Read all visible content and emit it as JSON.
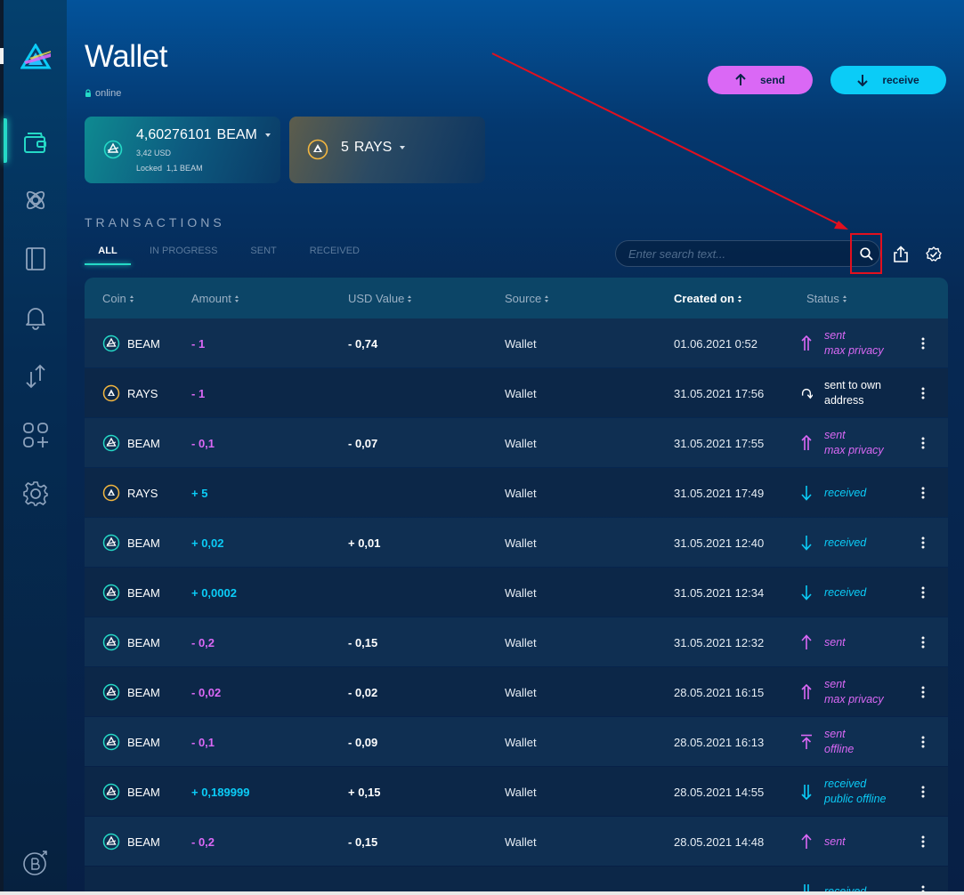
{
  "page": {
    "title": "Wallet",
    "status": "online"
  },
  "actions": {
    "send_label": "send",
    "receive_label": "receive"
  },
  "assets": {
    "beam": {
      "amount": "4,60276101",
      "unit": "BEAM",
      "usd": "3,42 USD",
      "locked_label": "Locked",
      "locked_value": "1,1 BEAM"
    },
    "rays": {
      "amount": "5",
      "unit": "RAYS"
    }
  },
  "transactions": {
    "section_title": "TRANSACTIONS",
    "tabs": [
      {
        "label": "ALL",
        "active": true
      },
      {
        "label": "IN PROGRESS",
        "active": false
      },
      {
        "label": "SENT",
        "active": false
      },
      {
        "label": "RECEIVED",
        "active": false
      }
    ],
    "search_placeholder": "Enter search text...",
    "columns": [
      "Coin",
      "Amount",
      "USD Value",
      "Source",
      "Created on",
      "Status"
    ],
    "sorted_column": "Created on",
    "rows": [
      {
        "coin": "BEAM",
        "amount": "- 1",
        "usd": "- 0,74",
        "source": "Wallet",
        "created": "01.06.2021 0:52",
        "status": "sent",
        "status_detail": "max privacy",
        "kind": "sent-mp"
      },
      {
        "coin": "RAYS",
        "amount": "- 1",
        "usd": "",
        "source": "Wallet",
        "created": "31.05.2021 17:56",
        "status": "sent to own",
        "status_detail": "address",
        "kind": "own"
      },
      {
        "coin": "BEAM",
        "amount": "- 0,1",
        "usd": "- 0,07",
        "source": "Wallet",
        "created": "31.05.2021 17:55",
        "status": "sent",
        "status_detail": "max privacy",
        "kind": "sent-mp"
      },
      {
        "coin": "RAYS",
        "amount": "+ 5",
        "usd": "",
        "source": "Wallet",
        "created": "31.05.2021 17:49",
        "status": "received",
        "status_detail": "",
        "kind": "received"
      },
      {
        "coin": "BEAM",
        "amount": "+ 0,02",
        "usd": "+ 0,01",
        "source": "Wallet",
        "created": "31.05.2021 12:40",
        "status": "received",
        "status_detail": "",
        "kind": "received"
      },
      {
        "coin": "BEAM",
        "amount": "+ 0,0002",
        "usd": "",
        "source": "Wallet",
        "created": "31.05.2021 12:34",
        "status": "received",
        "status_detail": "",
        "kind": "received"
      },
      {
        "coin": "BEAM",
        "amount": "- 0,2",
        "usd": "- 0,15",
        "source": "Wallet",
        "created": "31.05.2021 12:32",
        "status": "sent",
        "status_detail": "",
        "kind": "sent"
      },
      {
        "coin": "BEAM",
        "amount": "- 0,02",
        "usd": "- 0,02",
        "source": "Wallet",
        "created": "28.05.2021 16:15",
        "status": "sent",
        "status_detail": "max privacy",
        "kind": "sent-mp"
      },
      {
        "coin": "BEAM",
        "amount": "- 0,1",
        "usd": "- 0,09",
        "source": "Wallet",
        "created": "28.05.2021 16:13",
        "status": "sent",
        "status_detail": "offline",
        "kind": "sent-off"
      },
      {
        "coin": "BEAM",
        "amount": "+ 0,189999",
        "usd": "+ 0,15",
        "source": "Wallet",
        "created": "28.05.2021 14:55",
        "status": "received",
        "status_detail": "public offline",
        "kind": "recv-pub"
      },
      {
        "coin": "BEAM",
        "amount": "- 0,2",
        "usd": "- 0,15",
        "source": "Wallet",
        "created": "28.05.2021 14:48",
        "status": "sent",
        "status_detail": "",
        "kind": "sent"
      },
      {
        "coin": "",
        "amount": "",
        "usd": "",
        "source": "",
        "created": "",
        "status": "received",
        "status_detail": "",
        "kind": "recv-pub"
      }
    ]
  },
  "colors": {
    "accent_teal": "#25d9c6",
    "sent_purple": "#da68f5",
    "received_cyan": "#0bccf7",
    "annotation_red": "#e3101e"
  }
}
